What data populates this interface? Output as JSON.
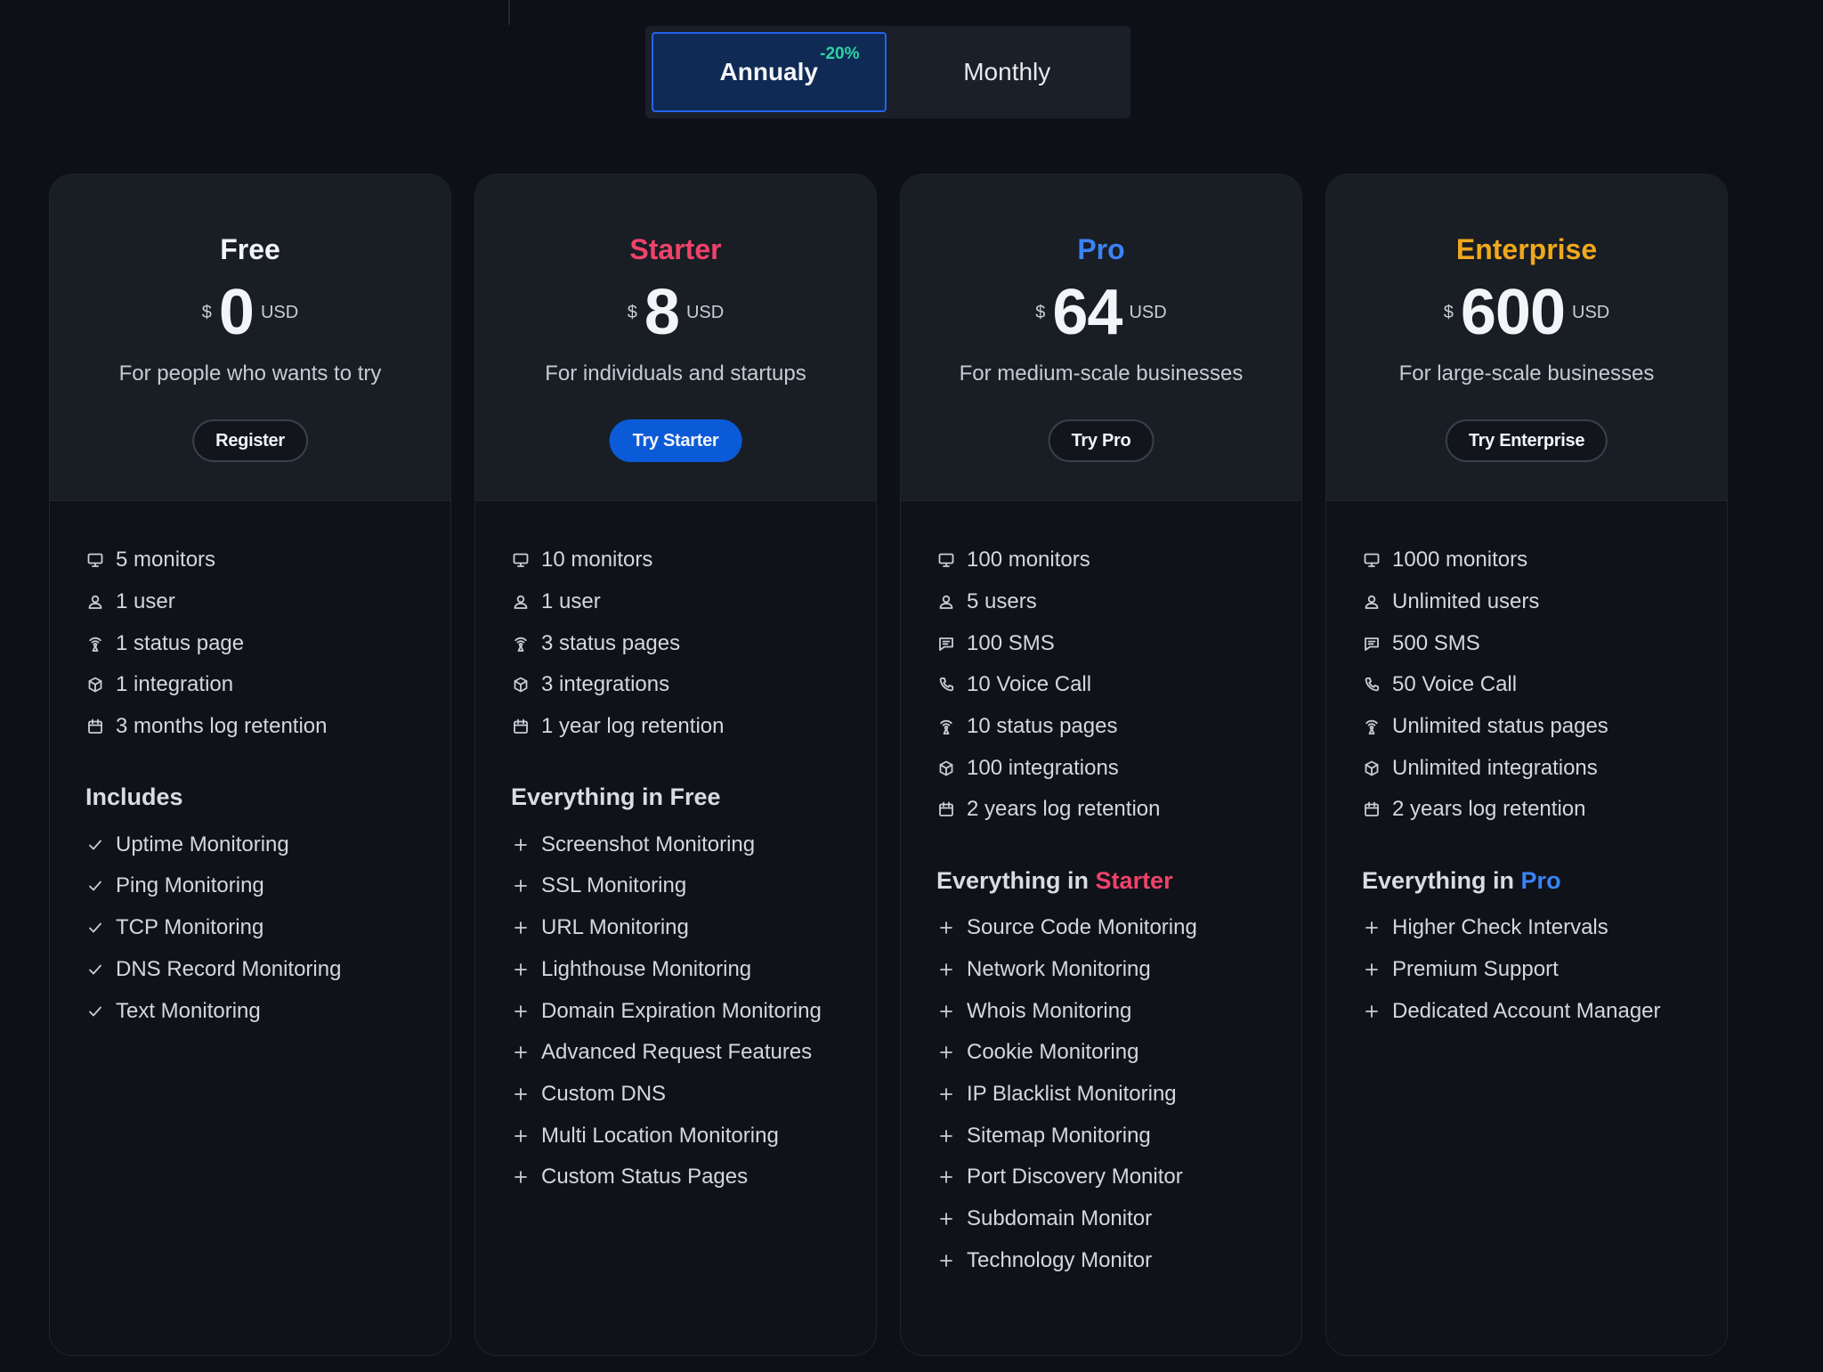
{
  "billing": {
    "annual_label": "Annualy",
    "annual_discount": "-20%",
    "monthly_label": "Monthly"
  },
  "colors": {
    "free": "#f2f4f7",
    "starter": "#f0426a",
    "pro": "#3b82f6",
    "enterprise": "#f0a81c",
    "primary_button": "#0b5bd8",
    "discount": "#2ed3a5"
  },
  "plans": [
    {
      "name": "Free",
      "currency": "$",
      "price": "0",
      "unit": "USD",
      "description": "For people who wants to try",
      "cta": "Register",
      "limits": [
        {
          "icon": "monitor-icon",
          "text": "5 monitors"
        },
        {
          "icon": "user-icon",
          "text": "1 user"
        },
        {
          "icon": "broadcast-icon",
          "text": "1 status page"
        },
        {
          "icon": "integration-icon",
          "text": "1 integration"
        },
        {
          "icon": "calendar-icon",
          "text": "3 months log retention"
        }
      ],
      "section_title_prefix": "Includes",
      "section_title_accent": "",
      "features": [
        {
          "icon": "check-icon",
          "text": "Uptime Monitoring"
        },
        {
          "icon": "check-icon",
          "text": "Ping Monitoring"
        },
        {
          "icon": "check-icon",
          "text": "TCP Monitoring"
        },
        {
          "icon": "check-icon",
          "text": "DNS Record Monitoring"
        },
        {
          "icon": "check-icon",
          "text": "Text Monitoring"
        }
      ]
    },
    {
      "name": "Starter",
      "currency": "$",
      "price": "8",
      "unit": "USD",
      "description": "For individuals and startups",
      "cta": "Try Starter",
      "limits": [
        {
          "icon": "monitor-icon",
          "text": "10 monitors"
        },
        {
          "icon": "user-icon",
          "text": "1 user"
        },
        {
          "icon": "broadcast-icon",
          "text": "3 status pages"
        },
        {
          "icon": "integration-icon",
          "text": "3 integrations"
        },
        {
          "icon": "calendar-icon",
          "text": "1 year log retention"
        }
      ],
      "section_title_prefix": "Everything in Free",
      "section_title_accent": "",
      "features": [
        {
          "icon": "plus-icon",
          "text": "Screenshot Monitoring"
        },
        {
          "icon": "plus-icon",
          "text": "SSL Monitoring"
        },
        {
          "icon": "plus-icon",
          "text": "URL Monitoring"
        },
        {
          "icon": "plus-icon",
          "text": "Lighthouse Monitoring"
        },
        {
          "icon": "plus-icon",
          "text": "Domain Expiration Monitoring"
        },
        {
          "icon": "plus-icon",
          "text": "Advanced Request Features"
        },
        {
          "icon": "plus-icon",
          "text": "Custom DNS"
        },
        {
          "icon": "plus-icon",
          "text": "Multi Location Monitoring"
        },
        {
          "icon": "plus-icon",
          "text": "Custom Status Pages"
        }
      ]
    },
    {
      "name": "Pro",
      "currency": "$",
      "price": "64",
      "unit": "USD",
      "description": "For medium-scale businesses",
      "cta": "Try Pro",
      "limits": [
        {
          "icon": "monitor-icon",
          "text": "100 monitors"
        },
        {
          "icon": "user-icon",
          "text": "5 users"
        },
        {
          "icon": "message-icon",
          "text": "100 SMS"
        },
        {
          "icon": "phone-icon",
          "text": "10 Voice Call"
        },
        {
          "icon": "broadcast-icon",
          "text": "10 status pages"
        },
        {
          "icon": "integration-icon",
          "text": "100 integrations"
        },
        {
          "icon": "calendar-icon",
          "text": "2 years log retention"
        }
      ],
      "section_title_prefix": "Everything in ",
      "section_title_accent": "Starter",
      "features": [
        {
          "icon": "plus-icon",
          "text": "Source Code Monitoring"
        },
        {
          "icon": "plus-icon",
          "text": "Network Monitoring"
        },
        {
          "icon": "plus-icon",
          "text": "Whois Monitoring"
        },
        {
          "icon": "plus-icon",
          "text": "Cookie Monitoring"
        },
        {
          "icon": "plus-icon",
          "text": "IP Blacklist Monitoring"
        },
        {
          "icon": "plus-icon",
          "text": "Sitemap Monitoring"
        },
        {
          "icon": "plus-icon",
          "text": "Port Discovery Monitor"
        },
        {
          "icon": "plus-icon",
          "text": "Subdomain Monitor"
        },
        {
          "icon": "plus-icon",
          "text": "Technology Monitor"
        }
      ]
    },
    {
      "name": "Enterprise",
      "currency": "$",
      "price": "600",
      "unit": "USD",
      "description": "For large-scale businesses",
      "cta": "Try Enterprise",
      "limits": [
        {
          "icon": "monitor-icon",
          "text": "1000 monitors"
        },
        {
          "icon": "user-icon",
          "text": "Unlimited users"
        },
        {
          "icon": "message-icon",
          "text": "500 SMS"
        },
        {
          "icon": "phone-icon",
          "text": "50 Voice Call"
        },
        {
          "icon": "broadcast-icon",
          "text": "Unlimited status pages"
        },
        {
          "icon": "integration-icon",
          "text": "Unlimited integrations"
        },
        {
          "icon": "calendar-icon",
          "text": "2 years log retention"
        }
      ],
      "section_title_prefix": "Everything in ",
      "section_title_accent": "Pro",
      "features": [
        {
          "icon": "plus-icon",
          "text": "Higher Check Intervals"
        },
        {
          "icon": "plus-icon",
          "text": "Premium Support"
        },
        {
          "icon": "plus-icon",
          "text": "Dedicated Account Manager"
        }
      ]
    }
  ]
}
